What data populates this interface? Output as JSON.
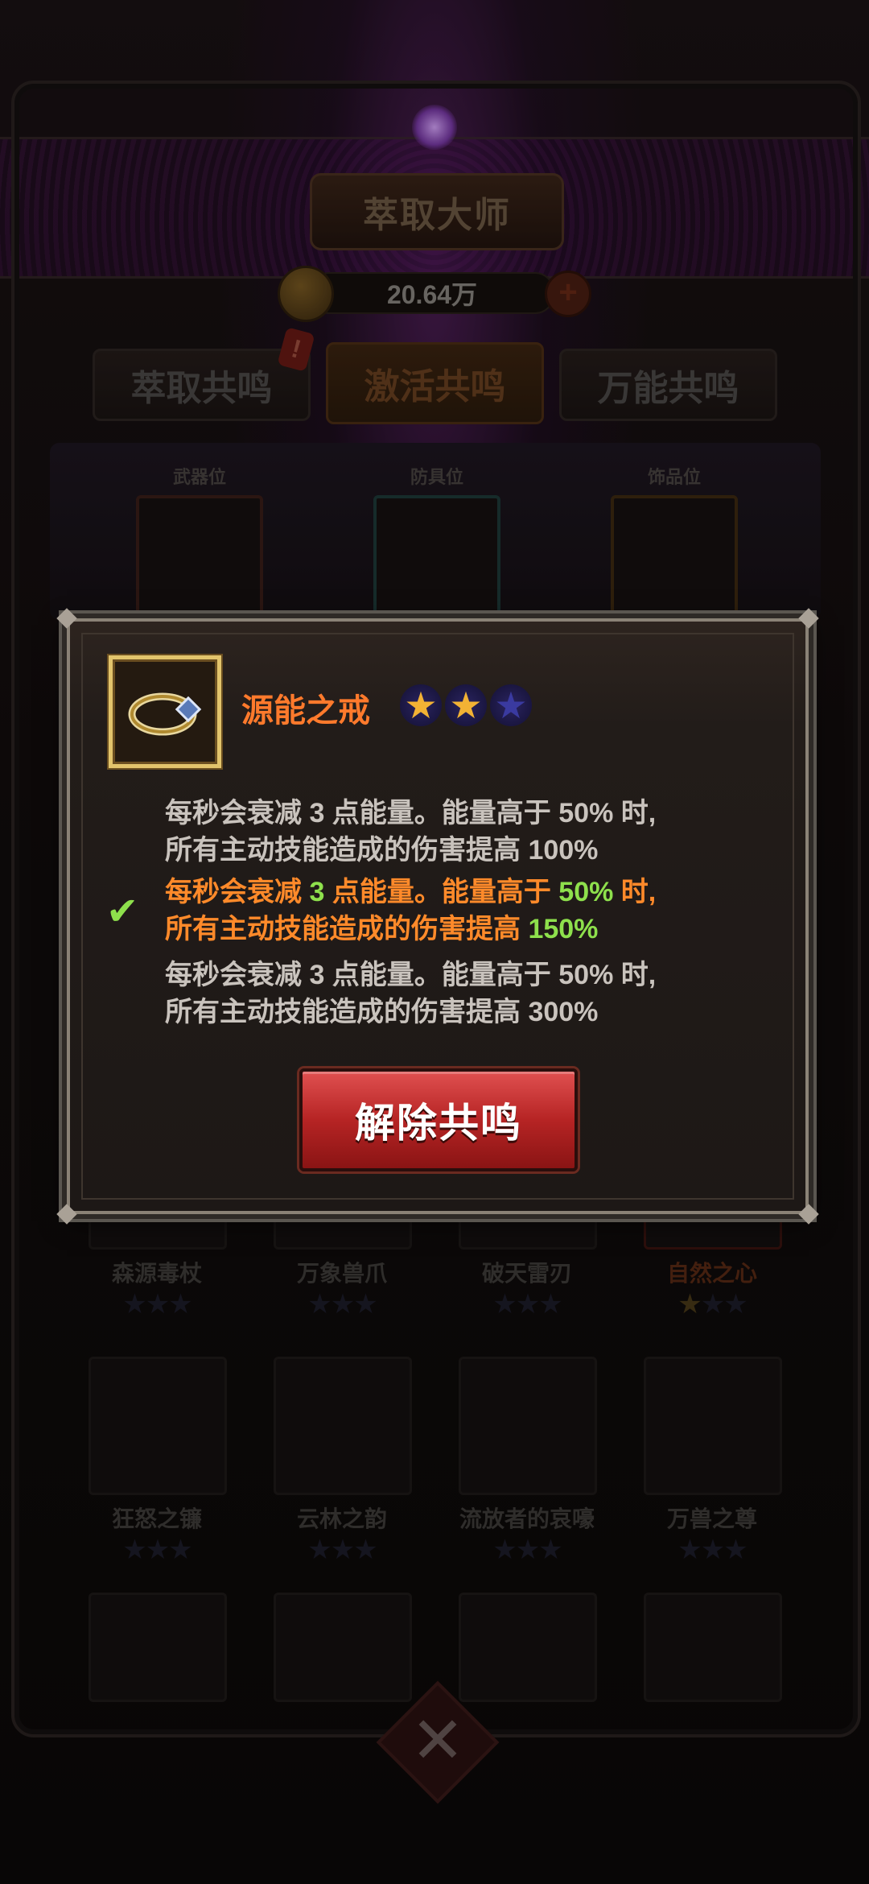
{
  "header": {
    "title": "萃取大师",
    "currency_amount": "20.64万",
    "plus_symbol": "+",
    "tab_badge": "!"
  },
  "tabs": [
    "萃取共鸣",
    "激活共鸣",
    "万能共鸣"
  ],
  "active_tab_index": 1,
  "slots": [
    {
      "label": "武器位",
      "icon": "scythe-icon"
    },
    {
      "label": "防具位",
      "icon": "armor-icon"
    },
    {
      "label": "饰品位",
      "icon": "ring-icon"
    }
  ],
  "grid_rows": [
    [
      {
        "name": "森源毒杖",
        "stars": "★★★",
        "gold_stars": 0
      },
      {
        "name": "万象兽爪",
        "stars": "★★★",
        "gold_stars": 0
      },
      {
        "name": "破天雷刃",
        "stars": "★★★",
        "gold_stars": 0
      },
      {
        "name": "自然之心",
        "stars": "★★★",
        "gold_stars": 1
      }
    ],
    [
      {
        "name": "狂怒之镰",
        "stars": "★★★",
        "gold_stars": 0
      },
      {
        "name": "云林之韵",
        "stars": "★★★",
        "gold_stars": 0
      },
      {
        "name": "流放者的哀嚎",
        "stars": "★★★",
        "gold_stars": 0
      },
      {
        "name": "万兽之尊",
        "stars": "★★★",
        "gold_stars": 0
      }
    ]
  ],
  "bottom_close_symbol": "✕",
  "modal": {
    "item_name": "源能之戒",
    "item_icon": "ring-icon",
    "star_rating": 2,
    "star_max": 3,
    "check_symbol": "✔",
    "effects": [
      {
        "line1": "每秒会衰减 3 点能量。能量高于 50% 时,",
        "line2": "所有主动技能造成的伤害提高 100%",
        "active": false
      },
      {
        "line1_pre": "每秒会衰减 ",
        "line1_num": "3",
        "line1_mid": " 点能量。能量高于 ",
        "line1_num2": "50%",
        "line1_post": " 时,",
        "line2_pre": "所有主动技能造成的伤害提高 ",
        "line2_num": "150%",
        "active": true
      },
      {
        "line1": "每秒会衰减 3 点能量。能量高于 50% 时,",
        "line2": "所有主动技能造成的伤害提高 300%",
        "active": false
      }
    ],
    "button_label": "解除共鸣"
  },
  "colors": {
    "item_name": "#ff7a2c",
    "active_effect": "#ff8a2a",
    "highlight_number": "#8ee04c",
    "button_red": "#b62424",
    "icon_border_gold": "#e2c46c"
  }
}
